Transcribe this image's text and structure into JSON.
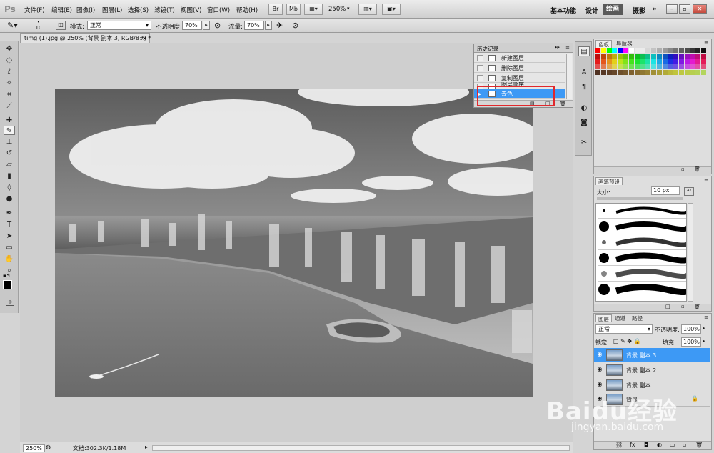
{
  "app": {
    "logo": "Ps"
  },
  "menu": [
    "文件(F)",
    "编辑(E)",
    "图像(I)",
    "图层(L)",
    "选择(S)",
    "滤镜(T)",
    "视图(V)",
    "窗口(W)",
    "帮助(H)"
  ],
  "menubar": {
    "br_label": "Br",
    "mb_label": "Mb",
    "zoom": "250%"
  },
  "workspaces": {
    "basic": "基本功能",
    "design": "设计",
    "paint": "绘画",
    "photo": "摄影"
  },
  "window_controls": {
    "minimize": "–",
    "restore": "▫",
    "close": "✕"
  },
  "options": {
    "brush_size": "10",
    "mode_label": "模式:",
    "mode_value": "正常",
    "opacity_label": "不透明度:",
    "opacity_value": "70%",
    "flow_label": "流量:",
    "flow_value": "70%"
  },
  "document": {
    "tab_title": "timg (1).jpg @ 250% (背景 副本 3, RGB/8#) *",
    "close": "×"
  },
  "status": {
    "zoom": "250%",
    "doc_info": "文档:302.3K/1.18M"
  },
  "history": {
    "title": "历史记录",
    "items": [
      {
        "label": "新建图层",
        "active": false
      },
      {
        "label": "删除图层",
        "active": false
      },
      {
        "label": "复制图层",
        "active": false
      },
      {
        "label": "图层顺序",
        "active": false
      },
      {
        "label": "去色",
        "active": true
      }
    ]
  },
  "color_panel": {
    "tab1": "色板",
    "tab2": "导航器"
  },
  "brush_panel": {
    "title": "画笔预设",
    "size_label": "大小:",
    "size_value": "10 px"
  },
  "layers_panel": {
    "tab1": "图层",
    "tab2": "通道",
    "tab3": "路径",
    "blend_mode": "正常",
    "opacity_label": "不透明度:",
    "opacity_value": "100%",
    "lock_label": "锁定:",
    "fill_label": "填充:",
    "fill_value": "100%",
    "layers": [
      {
        "name": "背景 副本 3",
        "selected": true
      },
      {
        "name": "背景 副本 2",
        "selected": false
      },
      {
        "name": "背景 副本",
        "selected": false
      },
      {
        "name": "背景",
        "selected": false
      }
    ]
  },
  "watermark": {
    "brand": "Baidu经验",
    "url": "jingyan.baidu.com"
  },
  "colors": {
    "selection": "#3d99f5",
    "highlight_box": "#e0282c",
    "panel_bg": "#dedede"
  }
}
